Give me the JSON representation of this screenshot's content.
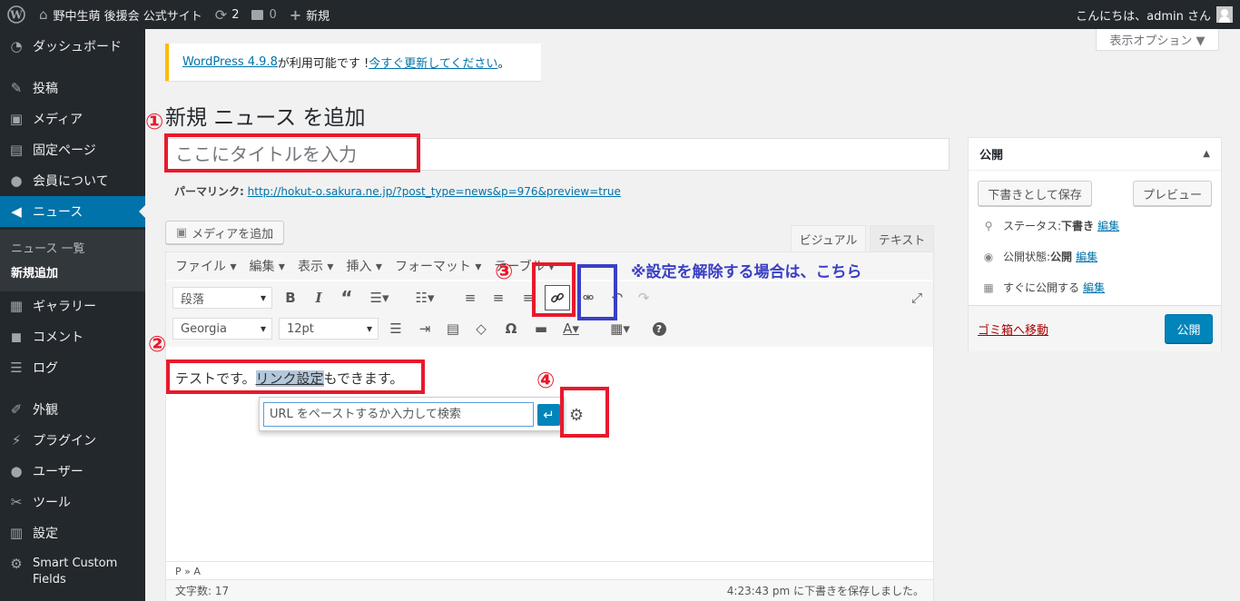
{
  "adminbar": {
    "site_name": "野中生萌 後援会 公式サイト",
    "updates_count": "2",
    "comments_count": "0",
    "new_label": "新規",
    "greeting": "こんにちは、admin さん"
  },
  "sidebar": {
    "items": [
      {
        "label": "ダッシュボード",
        "icon": "dashboard-icon"
      },
      {
        "label": "投稿",
        "icon": "pin-icon"
      },
      {
        "label": "メディア",
        "icon": "media-icon"
      },
      {
        "label": "固定ページ",
        "icon": "page-icon"
      },
      {
        "label": "会員について",
        "icon": "groups-icon"
      },
      {
        "label": "ニュース",
        "icon": "megaphone-icon"
      },
      {
        "label": "ギャラリー",
        "icon": "gallery-icon"
      },
      {
        "label": "コメント",
        "icon": "comment-icon"
      },
      {
        "label": "ログ",
        "icon": "list-icon"
      },
      {
        "label": "外観",
        "icon": "brush-icon"
      },
      {
        "label": "プラグイン",
        "icon": "plugin-icon"
      },
      {
        "label": "ユーザー",
        "icon": "user-icon"
      },
      {
        "label": "ツール",
        "icon": "wrench-icon"
      },
      {
        "label": "設定",
        "icon": "settings-icon"
      },
      {
        "label": "Smart Custom",
        "label2": "Fields",
        "icon": "gear-icon"
      }
    ],
    "submenu": [
      "ニュース 一覧",
      "新規追加"
    ]
  },
  "screen_options": "表示オプション ▼",
  "notice": {
    "link1": "WordPress 4.9.8",
    "text": " が利用可能です ! ",
    "link2": "今すぐ更新してください",
    "end": "。"
  },
  "page_title": "新規 ニュース を追加",
  "title_placeholder": "ここにタイトルを入力",
  "permalink": {
    "label": "パーマリンク:",
    "url": "http://hokut-o.sakura.ne.jp/?post_type=news&p=976&preview=true"
  },
  "editor": {
    "add_media": "メディアを追加",
    "tab_visual": "ビジュアル",
    "tab_text": "テキスト",
    "menus": [
      "ファイル ▾",
      "編集 ▾",
      "表示 ▾",
      "挿入 ▾",
      "フォーマット ▾",
      "テーブル ▾"
    ],
    "format_select": "段落",
    "font_select": "Georgia",
    "size_select": "12pt",
    "content_before": "テストです。",
    "content_link": "リンク設定",
    "content_after": "もできます。",
    "path": "P » A",
    "word_count": "文字数: 17",
    "autosave": "4:23:43 pm に下書きを保存しました。"
  },
  "link_popup": {
    "placeholder": "URL をペーストするか入力して検索"
  },
  "publish_box": {
    "title": "公開",
    "save_draft": "下書きとして保存",
    "preview": "プレビュー",
    "status_label": "ステータス: ",
    "status_value": "下書き",
    "visibility_label": "公開状態: ",
    "visibility_value": "公開",
    "schedule_label": "すぐに公開する",
    "edit": "編集",
    "trash": "ゴミ箱へ移動",
    "publish": "公開"
  },
  "annotations": {
    "n1": "①",
    "n2": "②",
    "n3": "③",
    "n4": "④",
    "note": "※設定を解除する場合は、こちら"
  },
  "colors": {
    "annotation_red": "#e8192c",
    "annotation_blue": "#3a3fc4",
    "wp_blue": "#0073aa",
    "adminbar_bg": "#23282d"
  }
}
